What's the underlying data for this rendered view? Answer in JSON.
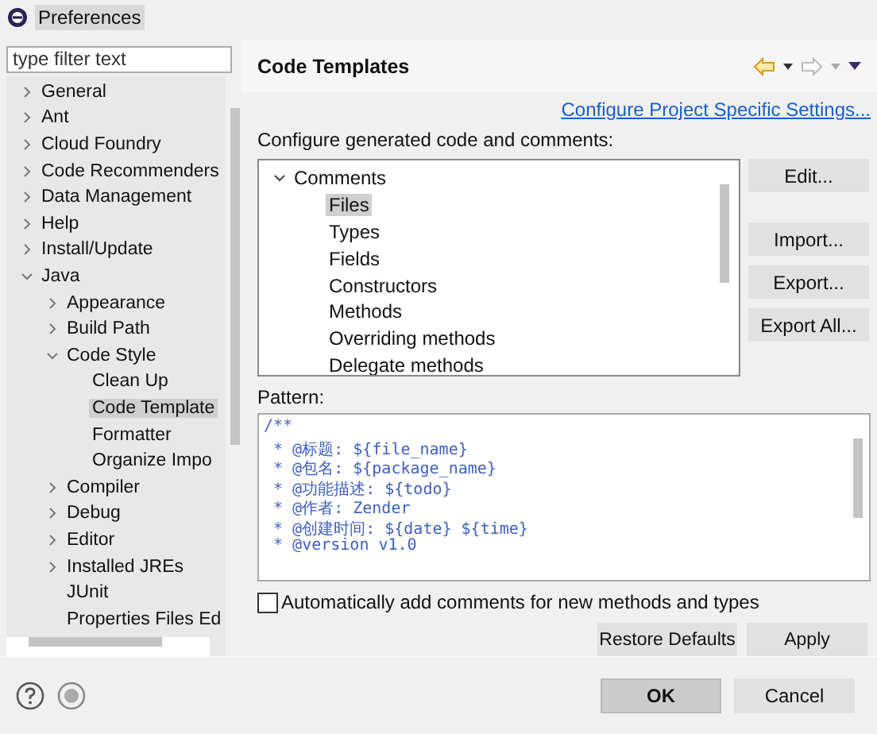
{
  "window": {
    "title": "Preferences"
  },
  "sidebar": {
    "filter": {
      "placeholder": "type filter text"
    },
    "items": [
      {
        "label": "General",
        "expanded": false,
        "selected": false
      },
      {
        "label": "Ant",
        "expanded": false,
        "selected": false
      },
      {
        "label": "Cloud Foundry",
        "expanded": false,
        "selected": false
      },
      {
        "label": "Code Recommenders",
        "expanded": false,
        "selected": false
      },
      {
        "label": "Data Management",
        "expanded": false,
        "selected": false
      },
      {
        "label": "Help",
        "expanded": false,
        "selected": false
      },
      {
        "label": "Install/Update",
        "expanded": false,
        "selected": false
      },
      {
        "label": "Java",
        "expanded": true,
        "selected": false,
        "children": [
          {
            "label": "Appearance",
            "expanded": false,
            "selected": false
          },
          {
            "label": "Build Path",
            "expanded": false,
            "selected": false
          },
          {
            "label": "Code Style",
            "expanded": true,
            "selected": false,
            "children": [
              {
                "label": "Clean Up",
                "selected": false
              },
              {
                "label": "Code Template",
                "selected": true
              },
              {
                "label": "Formatter",
                "selected": false
              },
              {
                "label": "Organize Impo",
                "selected": false
              }
            ]
          },
          {
            "label": "Compiler",
            "expanded": false,
            "selected": false
          },
          {
            "label": "Debug",
            "expanded": false,
            "selected": false
          },
          {
            "label": "Editor",
            "expanded": false,
            "selected": false
          },
          {
            "label": "Installed JREs",
            "expanded": false,
            "selected": false
          },
          {
            "label": "JUnit",
            "selected": false
          },
          {
            "label": "Properties Files Ed",
            "selected": false
          }
        ]
      }
    ]
  },
  "page": {
    "title": "Code Templates",
    "link": "Configure Project Specific Settings...",
    "prompt": "Configure generated code and comments:",
    "templates": [
      {
        "label": "Comments",
        "expanded": true,
        "selected": false,
        "children": [
          {
            "label": "Files",
            "selected": true
          },
          {
            "label": "Types",
            "selected": false
          },
          {
            "label": "Fields",
            "selected": false
          },
          {
            "label": "Constructors",
            "selected": false
          },
          {
            "label": "Methods",
            "selected": false
          },
          {
            "label": "Overriding methods",
            "selected": false
          },
          {
            "label": "Delegate methods",
            "selected": false
          }
        ]
      }
    ],
    "side_buttons": [
      "Edit...",
      "Import...",
      "Export...",
      "Export All..."
    ],
    "pattern_label": "Pattern:",
    "pattern": [
      "/**",
      " * @标题: ${file_name}",
      " * @包名: ${package_name}",
      " * @功能描述: ${todo}",
      " * @作者: Zender",
      " * @创建时间: ${date} ${time}",
      " * @version v1.0"
    ],
    "auto_comments": {
      "label": "Automatically add comments for new methods and types",
      "checked": false
    },
    "buttons": [
      "Restore Defaults",
      "Apply"
    ]
  },
  "footer": {
    "buttons": [
      {
        "label": "OK",
        "kind": "default"
      },
      {
        "label": "Cancel",
        "kind": "normal"
      }
    ]
  }
}
